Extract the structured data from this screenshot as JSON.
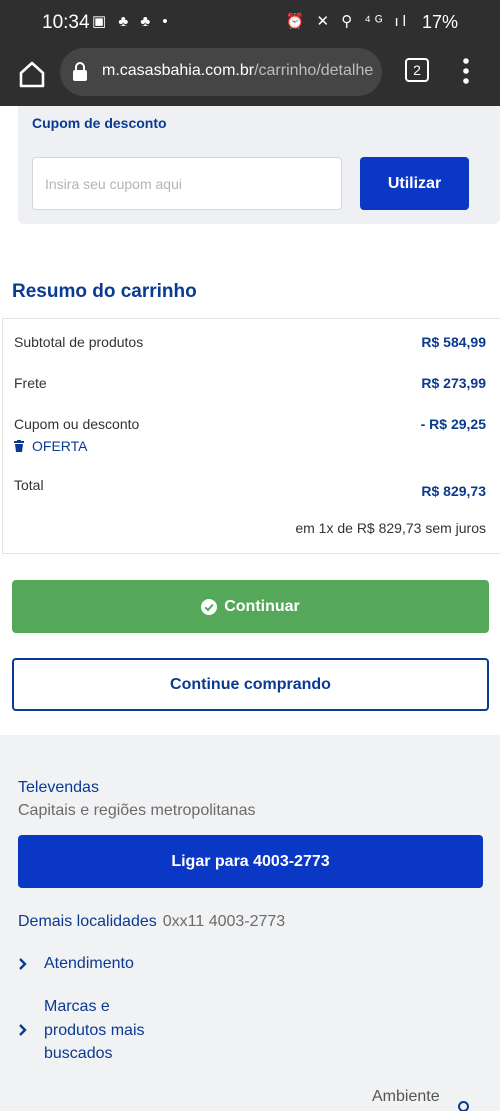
{
  "status_bar": {
    "time": "10:34",
    "left_icons": [
      "image-icon",
      "app-icon",
      "app-icon",
      "dot-icon"
    ],
    "right_icons": [
      "alarm-icon",
      "mute-icon",
      "location-icon",
      "4g-icon",
      "signal-icon"
    ],
    "battery": "17%"
  },
  "browser": {
    "url_domain": "m.casasbahia.com.br",
    "url_path": "/carrinho/detalhes",
    "tab_count": "2"
  },
  "coupon": {
    "label": "Cupom de desconto",
    "placeholder": "Insira seu cupom aqui",
    "button": "Utilizar"
  },
  "summary": {
    "title": "Resumo do carrinho",
    "subtotal_label": "Subtotal de produtos",
    "subtotal_value": "R$ 584,99",
    "shipping_label": "Frete",
    "shipping_value": "R$ 273,99",
    "discount_label": "Cupom ou desconto",
    "discount_value": "- R$ 29,25",
    "discount_tag": "OFERTA",
    "total_label": "Total",
    "total_value": "R$ 829,73",
    "installments": "em 1x de R$ 829,73 sem juros"
  },
  "actions": {
    "continue": "Continuar",
    "keep_shopping": "Continue comprando"
  },
  "footer": {
    "telesales_title": "Televendas",
    "telesales_sub": "Capitais e regiões metropolitanas",
    "call_button": "Ligar para 4003-2773",
    "other_locations_label": "Demais localidades",
    "other_locations_number": "0xx11 4003-2773",
    "links": [
      "Atendimento",
      "Marcas e produtos mais buscados"
    ],
    "ambiente": "Ambiente"
  },
  "colors": {
    "brand_blue": "#0b37c5",
    "text_blue": "#0b3a91",
    "continue_green": "#55a85a"
  }
}
